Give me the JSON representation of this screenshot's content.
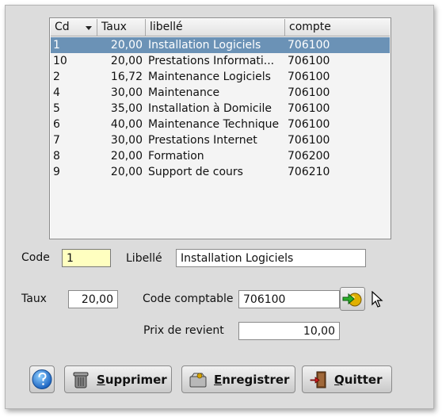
{
  "table": {
    "columns": [
      {
        "key": "cd",
        "label": "Cd"
      },
      {
        "key": "taux",
        "label": "Taux"
      },
      {
        "key": "libelle",
        "label": "libellé"
      },
      {
        "key": "compte",
        "label": "compte"
      }
    ],
    "rows": [
      {
        "cd": "1",
        "taux": "20,00",
        "libelle": "Installation Logiciels",
        "compte": "706100",
        "selected": true
      },
      {
        "cd": "10",
        "taux": "20,00",
        "libelle": "Prestations Informati...",
        "compte": "706100"
      },
      {
        "cd": "2",
        "taux": "16,72",
        "libelle": "Maintenance Logiciels",
        "compte": "706100"
      },
      {
        "cd": "4",
        "taux": "30,00",
        "libelle": "Maintenance",
        "compte": "706100"
      },
      {
        "cd": "5",
        "taux": "35,00",
        "libelle": "Installation à Domicile",
        "compte": "706100"
      },
      {
        "cd": "6",
        "taux": "40,00",
        "libelle": "Maintenance Technique",
        "compte": "706100"
      },
      {
        "cd": "7",
        "taux": "30,00",
        "libelle": "Prestations Internet",
        "compte": "706100"
      },
      {
        "cd": "8",
        "taux": "20,00",
        "libelle": "Formation",
        "compte": "706200"
      },
      {
        "cd": "9",
        "taux": "20,00",
        "libelle": "Support de cours",
        "compte": "706210"
      }
    ]
  },
  "form": {
    "code_label": "Code",
    "code_value": "1",
    "libelle_label": "Libellé",
    "libelle_value": "Installation Logiciels",
    "taux_label": "Taux",
    "taux_value": "20,00",
    "code_comptable_label": "Code comptable",
    "code_comptable_value": "706100",
    "prix_label": "Prix de revient",
    "prix_value": "10,00"
  },
  "buttons": {
    "help_icon": "help-globe-icon",
    "supprimer_first": "S",
    "supprimer_rest": "upprimer",
    "enregistrer_first": "E",
    "enregistrer_rest": "nregistrer",
    "quitter_first": "Q",
    "quitter_rest": "uitter"
  },
  "colors": {
    "selection": "#6b92b6",
    "focused_field": "#ffffc0",
    "window_bg": "#dcdcdc"
  }
}
